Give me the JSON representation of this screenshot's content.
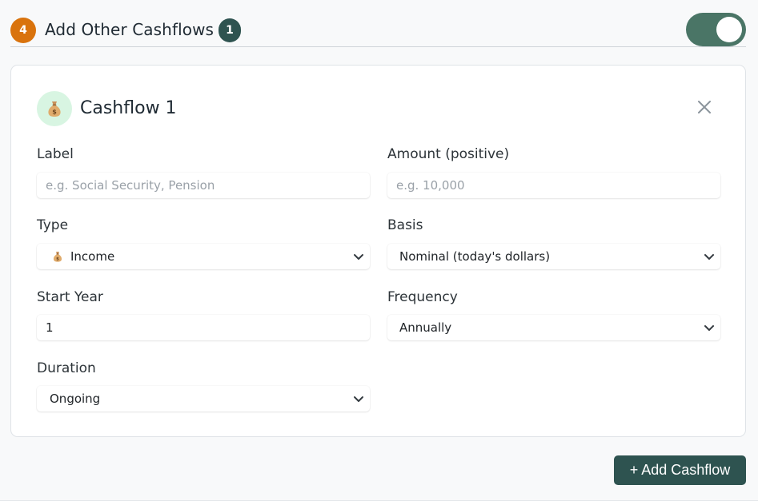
{
  "section": {
    "step_number": "4",
    "title": "Add Other Cashflows",
    "count": "1",
    "toggle_on": true
  },
  "card": {
    "title": "Cashflow 1",
    "icon": "money-bag-icon"
  },
  "fields": {
    "label": {
      "label": "Label",
      "value": "",
      "placeholder": "e.g. Social Security, Pension"
    },
    "amount": {
      "label": "Amount (positive)",
      "value": "",
      "placeholder": "e.g. 10,000"
    },
    "type": {
      "label": "Type",
      "value": "Income",
      "icon": "money-bag-icon"
    },
    "basis": {
      "label": "Basis",
      "value": "Nominal (today's dollars)"
    },
    "start_year": {
      "label": "Start Year",
      "value": "1"
    },
    "frequency": {
      "label": "Frequency",
      "value": "Annually"
    },
    "duration": {
      "label": "Duration",
      "value": "Ongoing"
    }
  },
  "actions": {
    "add_label": "+ Add Cashflow"
  },
  "colors": {
    "step_badge": "#d9730d",
    "accent_dark": "#2e5350",
    "toggle": "#4a7566",
    "icon_bg": "#d8f5e2"
  }
}
